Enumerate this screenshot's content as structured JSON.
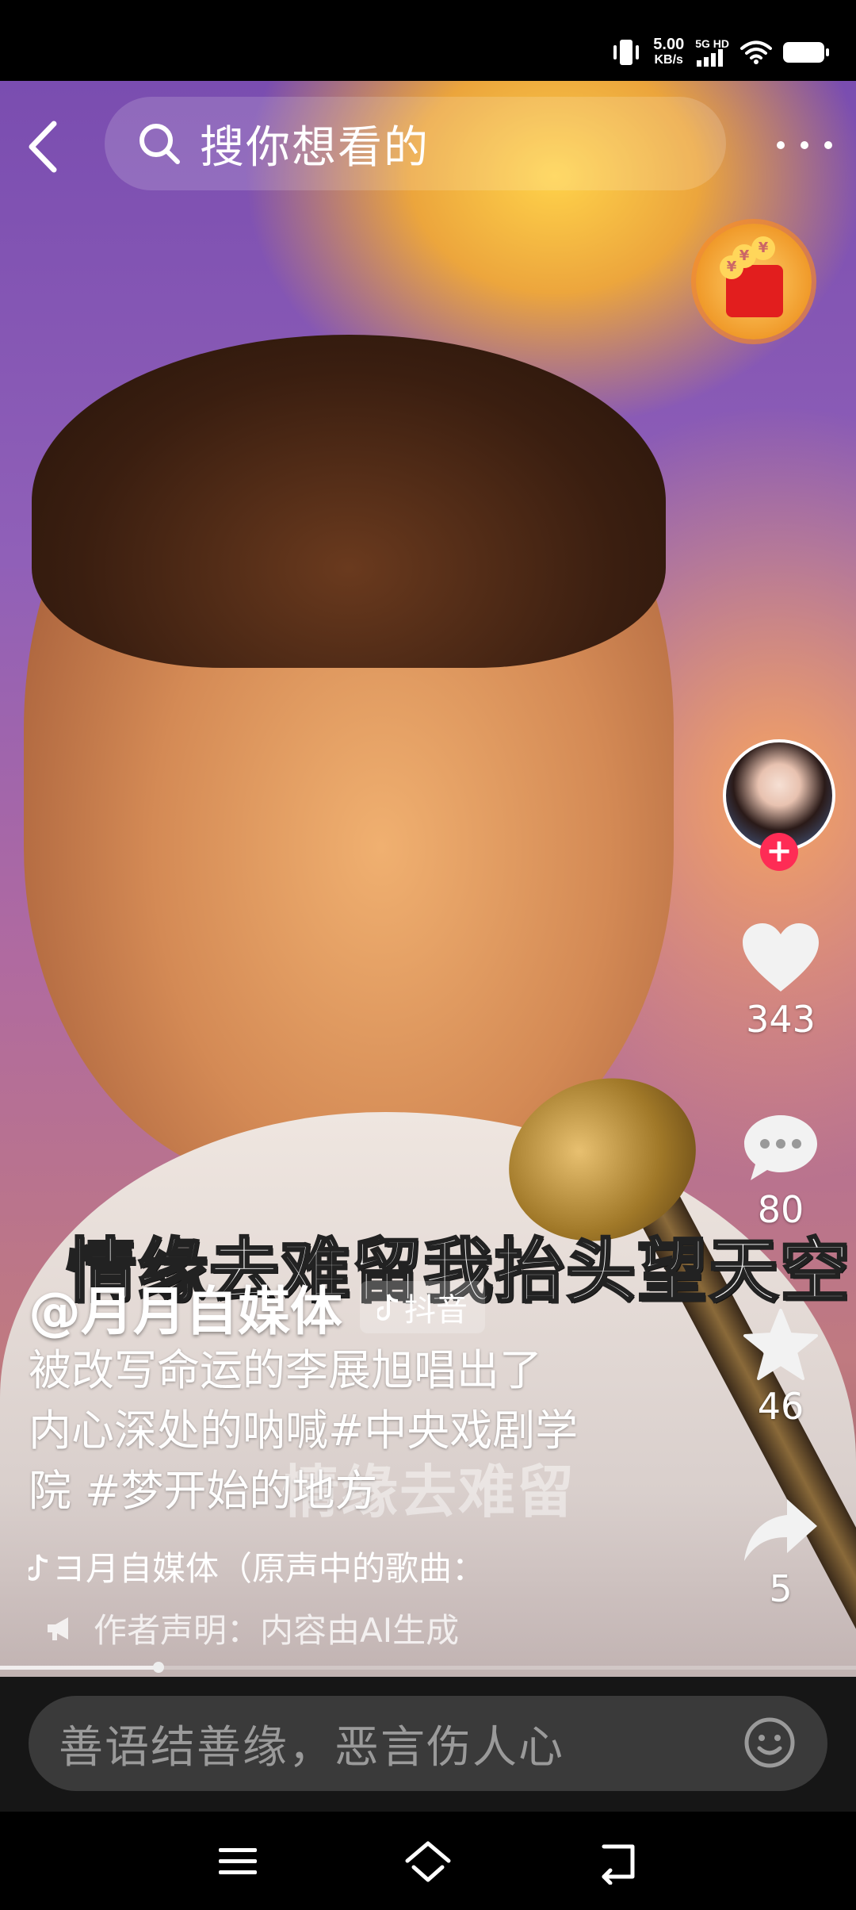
{
  "status_bar": {
    "speed_value": "5.00",
    "speed_unit": "KB/s",
    "network": "5G HD",
    "icons": [
      "vibrate-icon",
      "signal-icon",
      "wifi-icon",
      "battery-icon"
    ]
  },
  "top_bar": {
    "search_placeholder": "搜你想看的",
    "icons": [
      "back-icon",
      "search-icon",
      "more-icon",
      "red-packet-icon"
    ]
  },
  "subtitles": {
    "main": "情缘去难留我抬头望天空",
    "faint": "情缘去难留"
  },
  "actions": {
    "likes": "343",
    "comments": "80",
    "favorites": "46",
    "shares": "5"
  },
  "video_info": {
    "author": "@月月自媒体",
    "platform_tag": "抖音",
    "description_lines": [
      "被改写命运的李展旭唱出了",
      "内心深处的呐喊#中央戏剧学",
      "院 #梦开始的地方"
    ],
    "music": "ヨ月自媒体（原声中的歌曲：",
    "notice": "作者声明：内容由AI生成"
  },
  "playback": {
    "progress": 0.185
  },
  "comment_bar": {
    "placeholder": "善语结善缘，恶言伤人心"
  },
  "nav_bar": {
    "icons": [
      "menu-icon",
      "home-icon",
      "back-nav-icon"
    ]
  },
  "colors": {
    "accent": "#fe2c55",
    "comment_bar_bg": "#161616",
    "comment_input_bg": "#3a3a3a"
  }
}
